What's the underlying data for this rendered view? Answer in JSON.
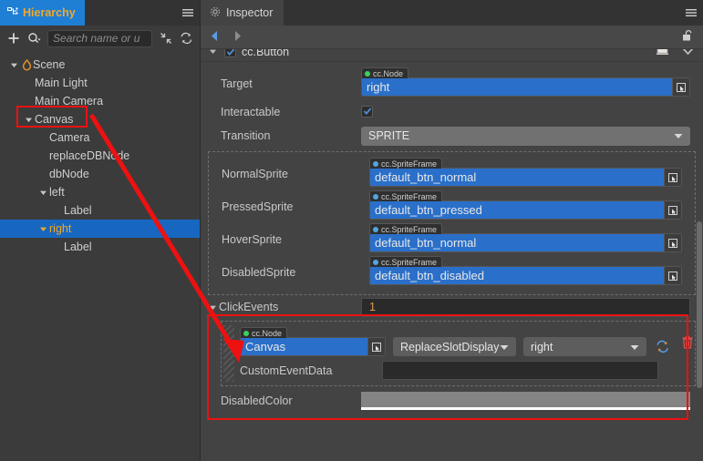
{
  "hierarchy": {
    "tab_label": "Hierarchy",
    "menu_icon": "hamburger-icon",
    "toolbar": {
      "add_icon": "plus-icon",
      "search_filter_icon": "search-dropdown-icon",
      "search_placeholder": "Search name or u",
      "search_value": "",
      "collapse_icon": "collapse-all-icon",
      "refresh_icon": "refresh-icon"
    },
    "tree": [
      {
        "label": "Scene",
        "depth": 0,
        "expanded": true,
        "icon": "scene-flame-icon",
        "selected": false
      },
      {
        "label": "Main Light",
        "depth": 1,
        "expanded": null,
        "icon": "",
        "selected": false
      },
      {
        "label": "Main Camera",
        "depth": 1,
        "expanded": null,
        "icon": "",
        "selected": false
      },
      {
        "label": "Canvas",
        "depth": 1,
        "expanded": true,
        "icon": "",
        "selected": false
      },
      {
        "label": "Camera",
        "depth": 2,
        "expanded": null,
        "icon": "",
        "selected": false
      },
      {
        "label": "replaceDBNode",
        "depth": 2,
        "expanded": null,
        "icon": "",
        "selected": false
      },
      {
        "label": "dbNode",
        "depth": 2,
        "expanded": null,
        "icon": "",
        "selected": false
      },
      {
        "label": "left",
        "depth": 2,
        "expanded": true,
        "icon": "",
        "selected": false
      },
      {
        "label": "Label",
        "depth": 3,
        "expanded": null,
        "icon": "",
        "selected": false
      },
      {
        "label": "right",
        "depth": 2,
        "expanded": true,
        "icon": "",
        "selected": true
      },
      {
        "label": "Label",
        "depth": 3,
        "expanded": null,
        "icon": "",
        "selected": false
      }
    ]
  },
  "inspector": {
    "tab_label": "Inspector",
    "tab_icon": "gear-icon",
    "menu_icon": "hamburger-icon",
    "nav": {
      "back_icon": "arrow-left-icon",
      "forward_icon": "arrow-right-icon",
      "lock_icon": "lock-open-icon"
    },
    "component": {
      "title": "cc.Button",
      "enabled": true,
      "expanded": true,
      "help_icon": "help-book-icon",
      "menu_icon": "chevron-down-icon"
    },
    "properties": {
      "target": {
        "label": "Target",
        "type_tag": "cc.Node",
        "type_dot_color": "#3bd05b",
        "value": "right",
        "pick_icon": "node-picker-icon"
      },
      "interactable": {
        "label": "Interactable",
        "checked": true
      },
      "transition": {
        "label": "Transition",
        "value": "SPRITE",
        "caret_icon": "chevron-down-icon"
      },
      "sprites": [
        {
          "label": "NormalSprite",
          "type_tag": "cc.SpriteFrame",
          "type_dot_color": "#53a5e0",
          "value": "default_btn_normal",
          "pick_icon": "asset-picker-icon"
        },
        {
          "label": "PressedSprite",
          "type_tag": "cc.SpriteFrame",
          "type_dot_color": "#53a5e0",
          "value": "default_btn_pressed",
          "pick_icon": "asset-picker-icon"
        },
        {
          "label": "HoverSprite",
          "type_tag": "cc.SpriteFrame",
          "type_dot_color": "#53a5e0",
          "value": "default_btn_normal",
          "pick_icon": "asset-picker-icon"
        },
        {
          "label": "DisabledSprite",
          "type_tag": "cc.SpriteFrame",
          "type_dot_color": "#53a5e0",
          "value": "default_btn_disabled",
          "pick_icon": "asset-picker-icon"
        }
      ],
      "click_events": {
        "label": "ClickEvents",
        "expanded": true,
        "count": "1",
        "entry": {
          "target_type_tag": "cc.Node",
          "target_type_dot_color": "#3bd05b",
          "target_value": "Canvas",
          "pick_icon": "node-picker-icon",
          "component_value": "ReplaceSlotDisplay",
          "handler_value": "right",
          "caret_icon": "chevron-down-icon",
          "refresh_icon": "refresh-icon",
          "delete_icon": "trash-icon",
          "custom_event_data_label": "CustomEventData",
          "custom_event_data_value": ""
        }
      },
      "disabled_color": {
        "label": "DisabledColor",
        "swatch_color": "#848484"
      }
    }
  },
  "annotations": {
    "highlight_color": "#ee1111",
    "boxes": [
      {
        "name": "canvas-node-highlight"
      },
      {
        "name": "clickevents-highlight"
      }
    ],
    "arrow": {
      "name": "canvas-to-clickevent-arrow"
    }
  }
}
